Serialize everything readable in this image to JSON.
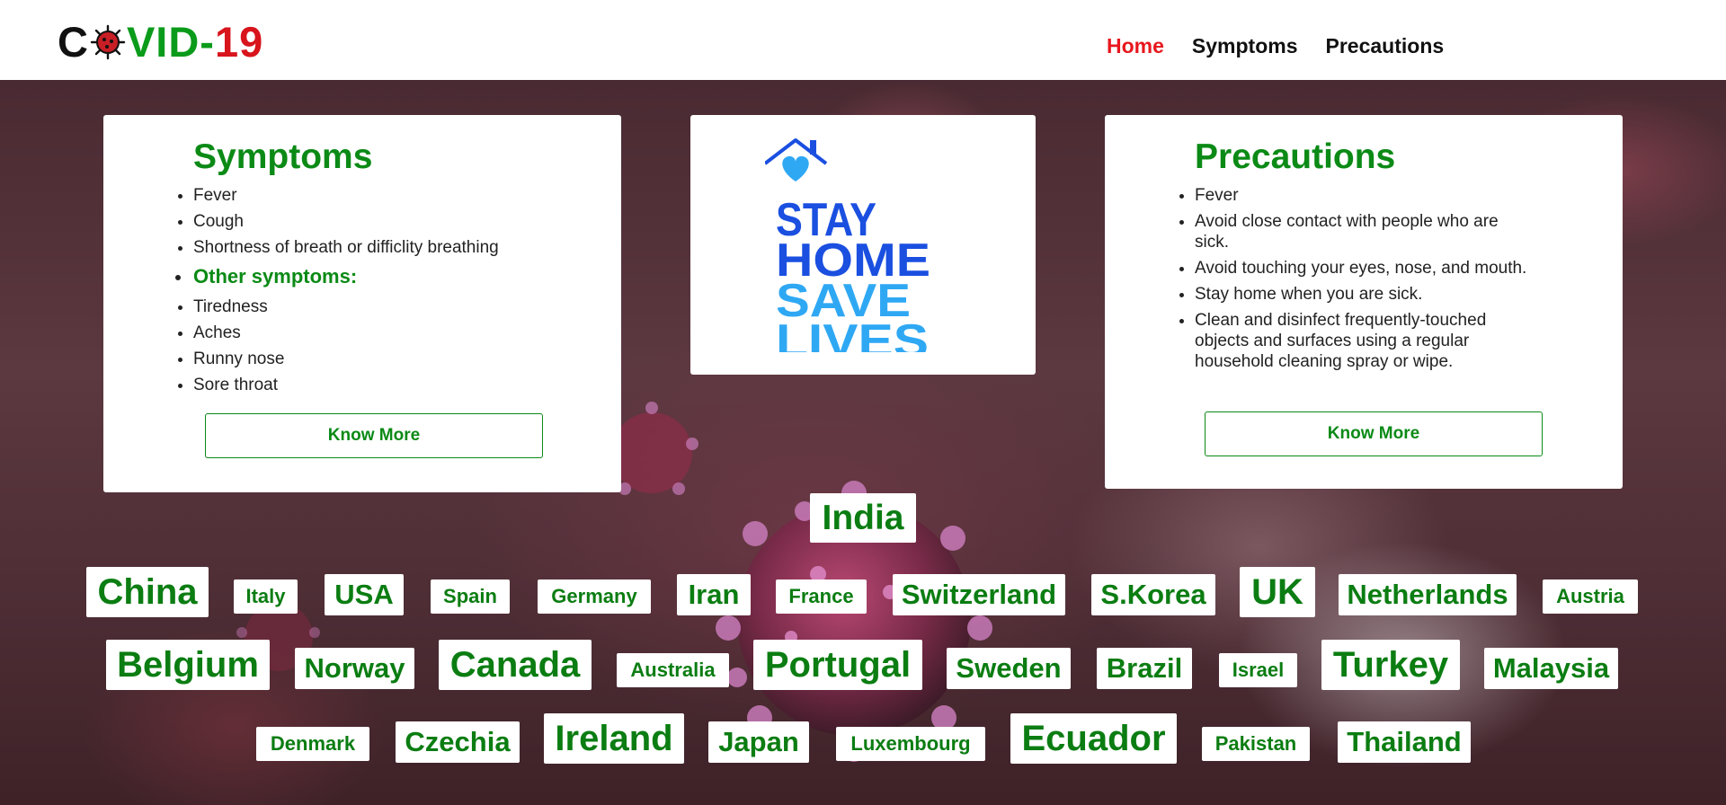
{
  "brand": {
    "logo_c": "C",
    "logo_vid": "VID-",
    "logo_num": "19"
  },
  "nav": {
    "items": [
      {
        "label": "Home",
        "active": true
      },
      {
        "label": "Symptoms",
        "active": false
      },
      {
        "label": "Precautions",
        "active": false
      }
    ]
  },
  "symptoms_card": {
    "title": "Symptoms",
    "main": [
      "Fever",
      "Cough",
      "Shortness of breath or difficlity breathing"
    ],
    "other_heading": "Other symptoms:",
    "other": [
      "Tiredness",
      "Aches",
      "Runny nose",
      "Sore throat"
    ],
    "button": "Know More"
  },
  "stay_home": {
    "line1": "STAY",
    "line2": "HOME",
    "line3": "SAVE",
    "line4": "LIVES"
  },
  "precautions_card": {
    "title": "Precautions",
    "items": [
      "Fever",
      "Avoid close contact with people who are sick.",
      "Avoid touching your eyes, nose, and mouth.",
      "Stay home when you are sick.",
      "Clean and disinfect frequently-touched objects and surfaces using a regular household cleaning spray or wipe."
    ],
    "button": "Know More"
  },
  "countries": {
    "row0": [
      "India"
    ],
    "row1": [
      "China",
      "Italy",
      "USA",
      "Spain",
      "Germany",
      "Iran",
      "France",
      "Switzerland",
      "S.Korea",
      "UK",
      "Netherlands",
      "Austria"
    ],
    "row2": [
      "Belgium",
      "Norway",
      "Canada",
      "Australia",
      "Portugal",
      "Sweden",
      "Brazil",
      "Israel",
      "Turkey",
      "Malaysia"
    ],
    "row3": [
      "Denmark",
      "Czechia",
      "Ireland",
      "Japan",
      "Luxembourg",
      "Ecuador",
      "Pakistan",
      "Thailand"
    ]
  },
  "colors": {
    "accent_green": "#0b8a16",
    "nav_active_red": "#e8171e",
    "logo_red": "#d8141c",
    "stay_home_dark_blue": "#1a4fe0",
    "stay_home_light_blue": "#2fa8f4"
  }
}
